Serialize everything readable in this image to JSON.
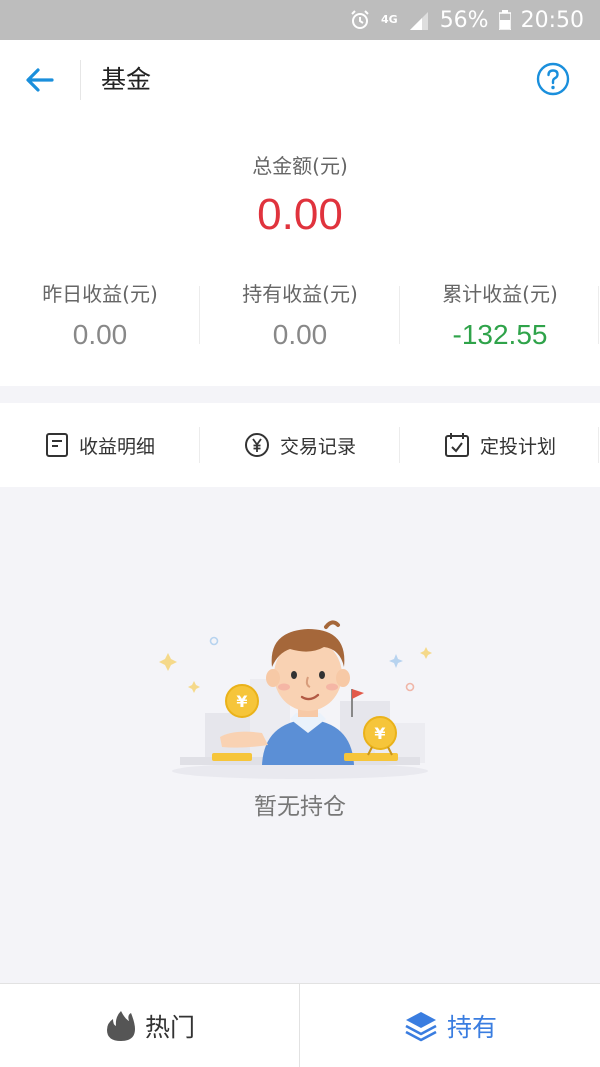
{
  "status_bar": {
    "network": "4G",
    "battery": "56%",
    "time": "20:50"
  },
  "header": {
    "title": "基金"
  },
  "summary": {
    "total_label": "总金额(元)",
    "total_value": "0.00",
    "stats": [
      {
        "label": "昨日收益(元)",
        "value": "0.00"
      },
      {
        "label": "持有收益(元)",
        "value": "0.00"
      },
      {
        "label": "累计收益(元)",
        "value": "-132.55"
      }
    ]
  },
  "actions": [
    {
      "label": "收益明细",
      "icon": "document-icon"
    },
    {
      "label": "交易记录",
      "icon": "yuan-circle-icon"
    },
    {
      "label": "定投计划",
      "icon": "calendar-check-icon"
    }
  ],
  "empty_state": {
    "text": "暂无持仓"
  },
  "tabs": [
    {
      "label": "热门",
      "icon": "flame-icon",
      "active": false
    },
    {
      "label": "持有",
      "icon": "layers-icon",
      "active": true
    }
  ],
  "colors": {
    "accent": "#1a8fdc",
    "total_value": "#e0333d",
    "negative_return": "#2fa34a",
    "tab_active": "#3a7de0",
    "tab_inactive": "#333333"
  }
}
